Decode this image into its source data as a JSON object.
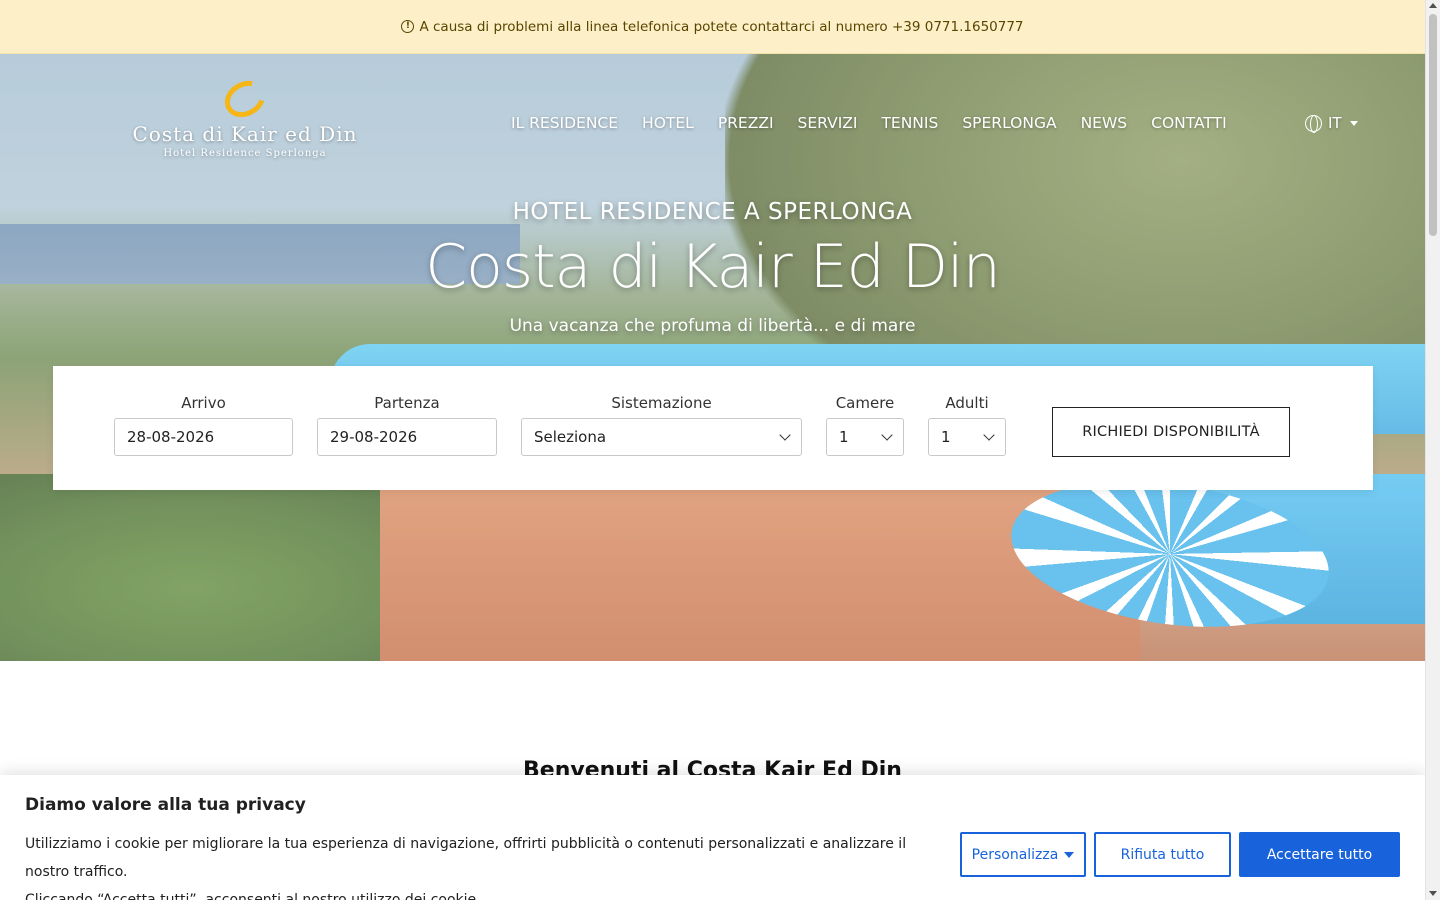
{
  "notice": {
    "text": "A causa di problemi alla linea telefonica potete contattarci al numero +39 0771.1650777"
  },
  "logo": {
    "name": "Costa di Kair ed Din",
    "subtitle": "Hotel Residence Sperlonga"
  },
  "nav": {
    "items": [
      "IL RESIDENCE",
      "HOTEL",
      "PREZZI",
      "SERVIZI",
      "TENNIS",
      "SPERLONGA",
      "NEWS",
      "CONTATTI"
    ],
    "language": "IT"
  },
  "hero": {
    "kicker": "HOTEL RESIDENCE A SPERLONGA",
    "title": "Costa di Kair Ed Din",
    "tagline": "Una vacanza che profuma di libertà... e di mare"
  },
  "booking": {
    "arrival_label": "Arrivo",
    "arrival_value": "28-08-2026",
    "departure_label": "Partenza",
    "departure_value": "29-08-2026",
    "accommodation_label": "Sistemazione",
    "accommodation_value": "Seleziona",
    "rooms_label": "Camere",
    "rooms_value": "1",
    "adults_label": "Adulti",
    "adults_value": "1",
    "submit_label": "RICHIEDI DISPONIBILITÀ"
  },
  "welcome": {
    "heading": "Benvenuti al Costa Kair Ed Din"
  },
  "cookie": {
    "title": "Diamo valore alla tua privacy",
    "line1": "Utilizziamo i cookie per migliorare la tua esperienza di navigazione, offrirti pubblicità o contenuti personalizzati e analizzare il nostro traffico.",
    "line2": "Cliccando “Accetta tutti”, acconsenti al nostro utilizzo dei cookie.",
    "customize_label": "Personalizza",
    "reject_label": "Rifiuta tutto",
    "accept_label": "Accettare tutto"
  },
  "colors": {
    "notice_bg": "#fdf0c8",
    "accent": "#1863dc",
    "logo_mark": "#f5b616"
  }
}
